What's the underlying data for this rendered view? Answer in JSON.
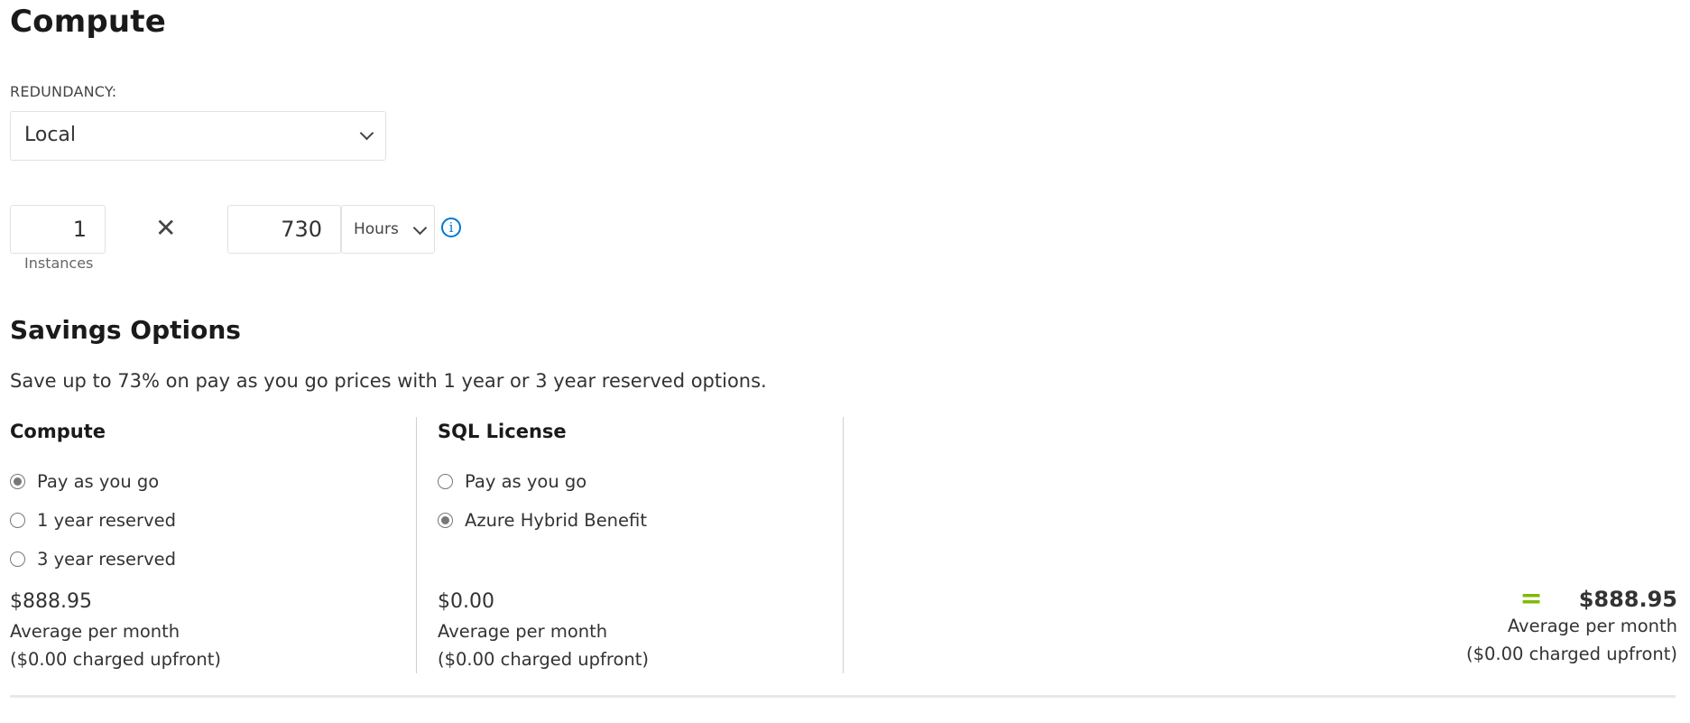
{
  "section_title": "Compute",
  "redundancy": {
    "label": "REDUNDANCY:",
    "selected": "Local"
  },
  "usage": {
    "instances_value": "1",
    "instances_label": "Instances",
    "multiply_symbol": "✕",
    "hours_value": "730",
    "unit_selected": "Hours",
    "info_icon": "i"
  },
  "savings": {
    "title": "Savings Options",
    "description": "Save up to 73% on pay as you go prices with 1 year or 3 year reserved options.",
    "compute": {
      "title": "Compute",
      "options": [
        {
          "label": "Pay as you go",
          "selected": true
        },
        {
          "label": "1 year reserved",
          "selected": false
        },
        {
          "label": "3 year reserved",
          "selected": false
        }
      ],
      "price": "$888.95",
      "price_sub": "Average per month",
      "upfront": "($0.00 charged upfront)"
    },
    "sql_license": {
      "title": "SQL License",
      "options": [
        {
          "label": "Pay as you go",
          "selected": false
        },
        {
          "label": "Azure Hybrid Benefit",
          "selected": true
        }
      ],
      "price": "$0.00",
      "price_sub": "Average per month",
      "upfront": "($0.00 charged upfront)"
    },
    "total": {
      "equals_symbol": "=",
      "price": "$888.95",
      "price_sub": "Average per month",
      "upfront": "($0.00 charged upfront)"
    }
  },
  "colors": {
    "accent_green": "#7fba00",
    "info_blue": "#0078d4"
  }
}
